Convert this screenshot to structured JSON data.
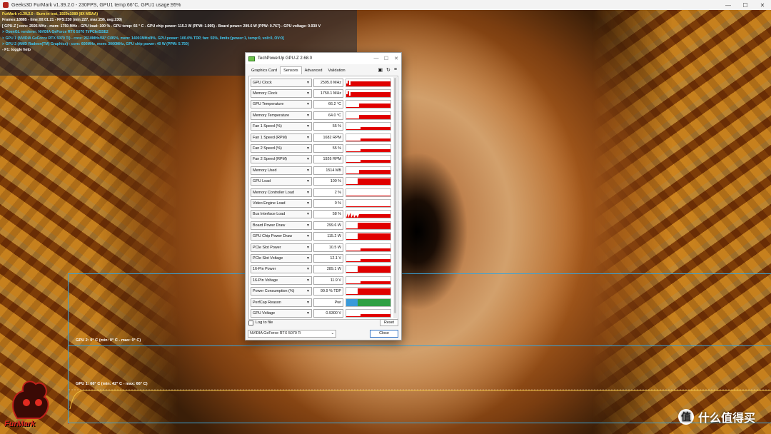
{
  "window": {
    "title": "Geeks3D FurMark v1.39.2.0 - 230FPS, GPU1 temp:66°C, GPU1 usage:95%"
  },
  "osd": {
    "lines": [
      {
        "text": "FurMark v1.39.2.0 - Burn-in test, 1920x1080 (8X MSAA)",
        "color": "yellow"
      },
      {
        "text": "Frames:18885 - time:00:01:21 - FPS:230 (min:227, max:236, avg:230)",
        "color": "white"
      },
      {
        "text": "[ GPU-Z ] core: 2595 MHz - mem: 1750 MHz - GPU load: 100 % - GPU temp: 66 ° C - GPU chip power: 115.3 W (PPW: 1.995) - Board power: 299.6 W (PPW: 0.767) - GPU voltage: 0.930 V",
        "color": "white"
      },
      {
        "text": "> OpenGL renderer: NVIDIA GeForce RTX 5070 Ti/PCIe/SSE2",
        "color": "cyan"
      },
      {
        "text": "> GPU 1 (NVIDIA GeForce RTX 5070 Ti) - core: 2610MHz/66° C/95%, mem: 14001MHz/8%, GPU power: 100.0% TDP, fan: 55%, limits:[power:1, temp:0, volt:0, OV:0]",
        "color": "cyan"
      },
      {
        "text": "> GPU 2 (AMD Radeon(TM) Graphics) - core: 600MHz, mem: 3000MHz, GPU chip power: 40 W (PPW: 5.750)",
        "color": "cyan"
      },
      {
        "text": "- F1: toggle help",
        "color": "white"
      }
    ]
  },
  "graphs": {
    "gpu2_label": "GPU 2: 0° C (min: 0° C - max: 0° C)",
    "gpu1_label": "GPU 1: 66° C (min: 42° C - max: 66° C)",
    "gpu1_temp": {
      "min": 42,
      "max": 66,
      "current": 66
    }
  },
  "logo": {
    "text": "FurMark"
  },
  "watermark": {
    "text": "什么值得买"
  },
  "gpuz": {
    "title": "TechPowerUp GPU-Z 2.68.0",
    "tabs": [
      "Graphics Card",
      "Sensors",
      "Advanced",
      "Validation"
    ],
    "active_tab": "Sensors",
    "sensors": [
      {
        "name": "GPU Clock",
        "value": "2595.0 MHz"
      },
      {
        "name": "Memory Clock",
        "value": "1750.1 MHz"
      },
      {
        "name": "GPU Temperature",
        "value": "66.2 °C"
      },
      {
        "name": "Memory Temperature",
        "value": "64.0 °C"
      },
      {
        "name": "Fan 1 Speed (%)",
        "value": "55 %"
      },
      {
        "name": "Fan 1 Speed (RPM)",
        "value": "1682 RPM"
      },
      {
        "name": "Fan 2 Speed (%)",
        "value": "55 %"
      },
      {
        "name": "Fan 2 Speed (RPM)",
        "value": "1926 RPM"
      },
      {
        "name": "Memory Used",
        "value": "1514 MB"
      },
      {
        "name": "GPU Load",
        "value": "100 %"
      },
      {
        "name": "Memory Controller Load",
        "value": "2 %"
      },
      {
        "name": "Video Engine Load",
        "value": "0 %"
      },
      {
        "name": "Bus Interface Load",
        "value": "58 %"
      },
      {
        "name": "Board Power Draw",
        "value": "299.6 W"
      },
      {
        "name": "GPU Chip Power Draw",
        "value": "115.2 W"
      },
      {
        "name": "PCIe Slot Power",
        "value": "10.5 W"
      },
      {
        "name": "PCIe Slot Voltage",
        "value": "12.1 V"
      },
      {
        "name": "16-Pin Power",
        "value": "289.1 W"
      },
      {
        "name": "16-Pin Voltage",
        "value": "11.9 V"
      },
      {
        "name": "Power Consumption (%)",
        "value": "99.9 % TDP"
      },
      {
        "name": "PerfCap Reason",
        "value": "Pwr"
      },
      {
        "name": "GPU Voltage",
        "value": "0.9300 V"
      }
    ],
    "log_to_file_label": "Log to file",
    "reset_label": "Reset",
    "device_select": "NVIDIA GeForce RTX 5070 Ti",
    "close_label": "Close",
    "colors": {
      "graph": "#e00000",
      "perfcap_pwr": "#2ea043",
      "perfcap_idle": "#3a9ad9"
    }
  }
}
